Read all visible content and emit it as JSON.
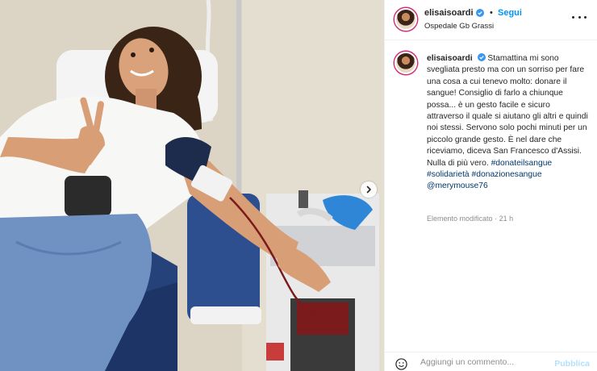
{
  "post": {
    "username": "elisaisoardi",
    "follow_label": "Segui",
    "separator": "•",
    "location": "Ospedale Gb Grassi",
    "caption": {
      "username": "elisaisoardi",
      "text": "Stamattina mi sono svegliata presto ma con un sorriso per fare una cosa a cui tenevo molto: donare il sangue! Consiglio di farlo a chiunque possa... è un gesto facile e sicuro attraverso il quale si aiutano gli altri e quindi noi stessi. Servono solo pochi minuti per un piccolo grande gesto. È nel dare che riceviamo, diceva San Francesco d'Assisi. Nulla di più vero.",
      "hashtags": [
        "#donateilsangue",
        "#solidarietà",
        "#donazionesangue",
        "@merymouse76"
      ]
    },
    "edited_label": "Elemento modificato",
    "time_separator": "·",
    "time_ago": "21 h"
  },
  "comment": {
    "placeholder": "Aggiungi un commento...",
    "publish_label": "Pubblica"
  },
  "colors": {
    "link_blue": "#0095f6",
    "hashtag": "#00376b",
    "verified": "#3897f0",
    "muted": "#8e8e8e",
    "publish_disabled": "#b2dffc"
  },
  "icons": {
    "verified": "verified-badge-icon",
    "more": "more-options-icon",
    "emoji": "emoji-icon",
    "next": "chevron-right-icon"
  }
}
